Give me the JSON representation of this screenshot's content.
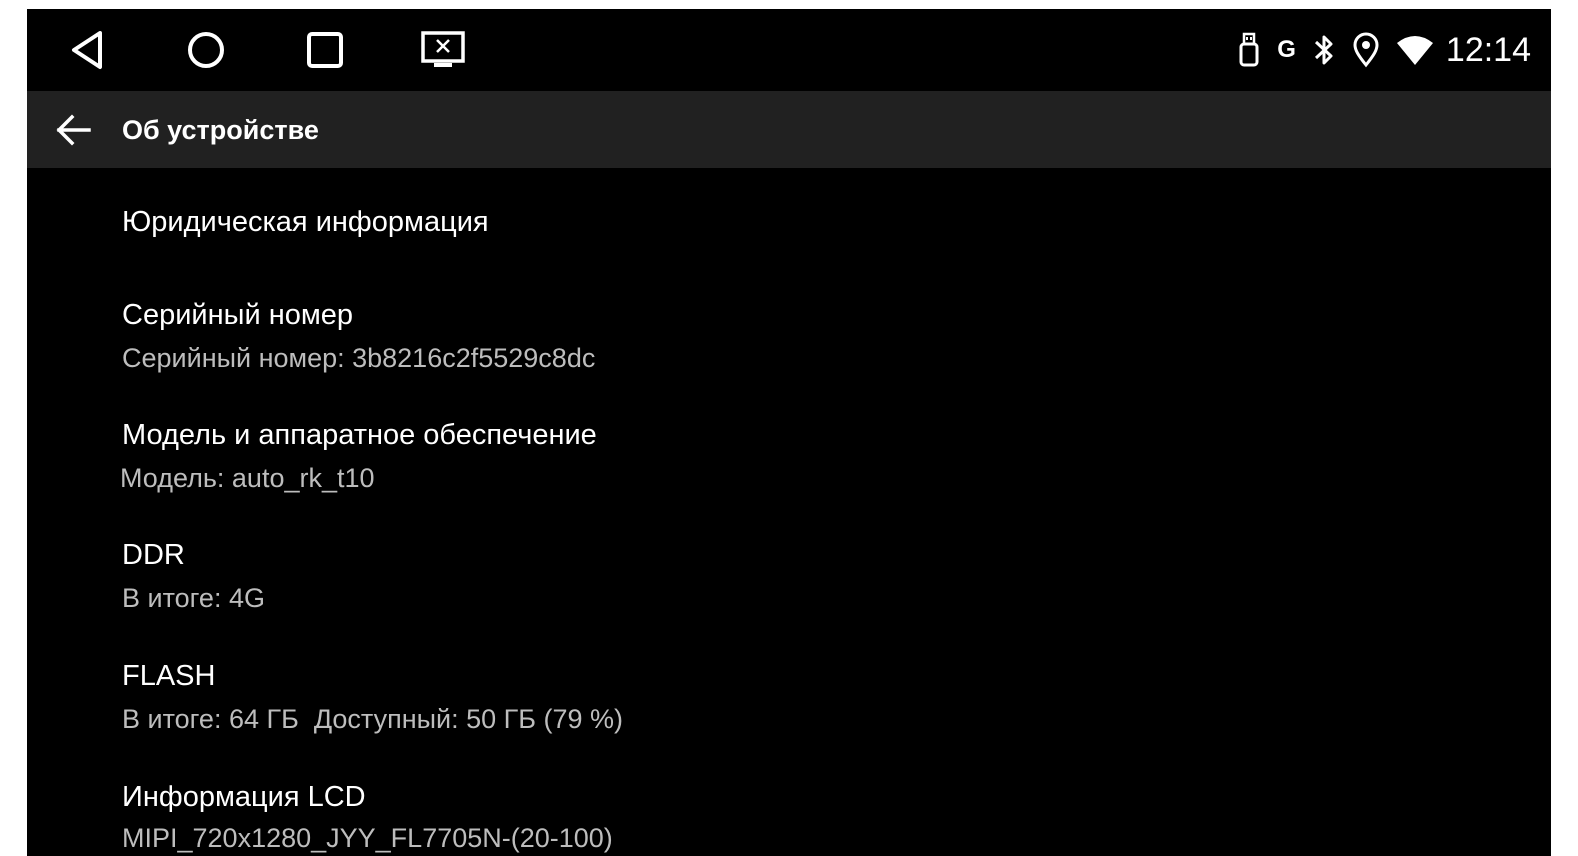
{
  "status_bar": {
    "nav_icons": [
      "back-triangle-icon",
      "home-circle-icon",
      "recents-square-icon",
      "screenshot-icon"
    ],
    "status_icons": [
      "usb-icon",
      "google-g-icon",
      "bluetooth-icon",
      "location-pin-icon",
      "wifi-icon"
    ],
    "g_letter": "G",
    "clock": "12:14"
  },
  "app_bar": {
    "title": "Об устройстве"
  },
  "preferences": [
    {
      "title": "Юридическая информация",
      "summary": ""
    },
    {
      "title": "Серийный номер",
      "summary": "Серийный номер: 3b8216c2f5529c8dc"
    },
    {
      "title": "Модель и аппаратное обеспечение",
      "summary": "Модель: auto_rk_t10"
    },
    {
      "title": "DDR",
      "summary": "В итоге: 4G"
    },
    {
      "title": "FLASH",
      "summary": "В итоге: 64 ГБ  Доступный: 50 ГБ (79 %)"
    },
    {
      "title": "Информация LCD",
      "summary": "MIPI_720x1280_JYY_FL7705N-(20-100)"
    }
  ],
  "colors": {
    "background": "#000000",
    "app_bar": "#212121",
    "primary_text": "#ffffff",
    "secondary_text": "#bdbdbd"
  }
}
